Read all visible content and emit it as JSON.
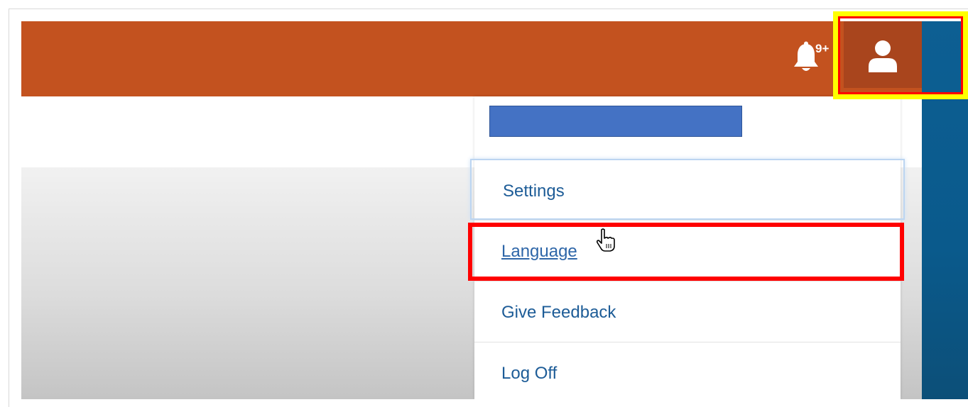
{
  "header": {
    "notification_badge": "9+",
    "icons": {
      "notifications": "bell-icon",
      "account": "user-icon"
    }
  },
  "account_menu": {
    "items": [
      {
        "label": "Settings"
      },
      {
        "label": "Language"
      },
      {
        "label": "Give Feedback"
      },
      {
        "label": "Log Off"
      }
    ]
  },
  "colors": {
    "topbar": "#c3521f",
    "avatar_button": "#a9451d",
    "side_panel": "#0d5f93",
    "menu_text": "#1d5c97",
    "redaction_bar": "#4472c4",
    "highlight_yellow": "#ffff00",
    "highlight_red": "#ff0000"
  }
}
